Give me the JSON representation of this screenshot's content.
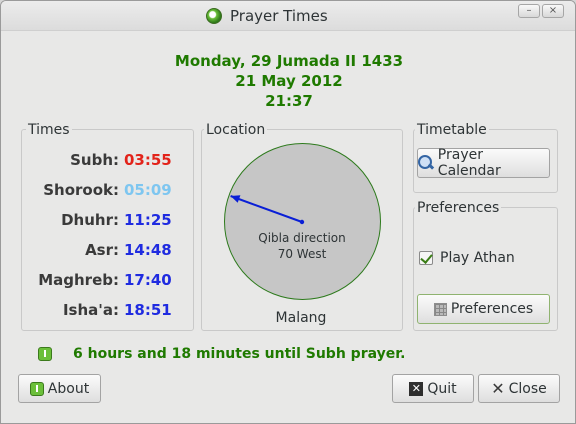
{
  "window": {
    "title": "Prayer Times",
    "app_icon": "prayer-times-app-icon",
    "controls": {
      "minimize": "–",
      "close": "×"
    }
  },
  "date": {
    "hijri": "Monday, 29 Jumada II 1433",
    "gregorian": "21 May 2012",
    "time": "21:37"
  },
  "times": {
    "label": "Times",
    "items": [
      {
        "name": "Subh:",
        "value": "03:55",
        "color": "#e2231a"
      },
      {
        "name": "Shorook:",
        "value": "05:09",
        "color": "#7ec6f0"
      },
      {
        "name": "Dhuhr:",
        "value": "11:25",
        "color": "#1f2be0"
      },
      {
        "name": "Asr:",
        "value": "14:48",
        "color": "#1f2be0"
      },
      {
        "name": "Maghreb:",
        "value": "17:40",
        "color": "#1f2be0"
      },
      {
        "name": "Isha'a:",
        "value": "18:51",
        "color": "#1f2be0"
      }
    ]
  },
  "location": {
    "label": "Location",
    "qibla_label": "Qibla direction",
    "qibla_value": "70 West",
    "qibla_bearing_degrees": 290,
    "city": "Malang"
  },
  "timetable": {
    "label": "Timetable",
    "calendar_button": "Prayer Calendar",
    "calendar_icon": "magnifier-icon"
  },
  "preferences": {
    "label": "Preferences",
    "play_athan_label": "Play Athan",
    "play_athan_checked": true,
    "preferences_button": "Preferences"
  },
  "status": {
    "message": "6 hours and 18 minutes until Subh prayer."
  },
  "footer": {
    "about": "About",
    "quit": "Quit",
    "close": "Close"
  },
  "colors": {
    "accent_green": "#1f7a00",
    "dial_border": "#2d7a1c",
    "needle": "#0a1fd6"
  }
}
